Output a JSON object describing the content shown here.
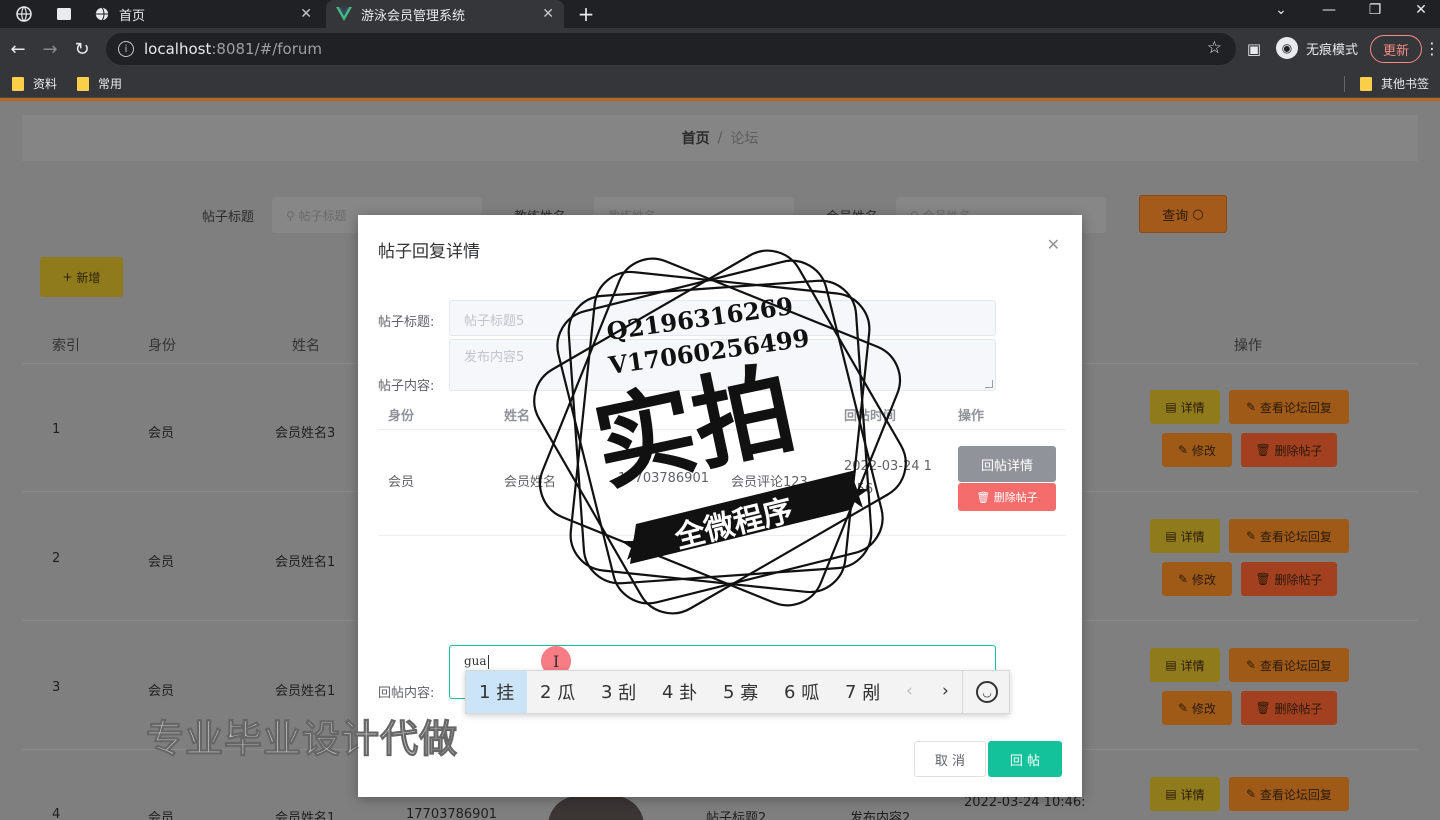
{
  "browser": {
    "tabs": [
      {
        "title": "首页",
        "active": false
      },
      {
        "title": "游泳会员管理系统",
        "active": true
      }
    ],
    "url_host": "localhost",
    "url_path": ":8081/#/forum",
    "profile_label": "无痕模式",
    "update_label": "更新",
    "bookmarks": [
      "资料",
      "常用"
    ],
    "other_bookmarks": "其他书签"
  },
  "page": {
    "breadcrumb": {
      "home": "首页",
      "current": "论坛"
    },
    "search": [
      {
        "label": "帖子标题",
        "placeholder": "帖子标题"
      },
      {
        "label": "教练姓名",
        "placeholder": "教练姓名"
      },
      {
        "label": "会员姓名",
        "placeholder": "会员姓名"
      }
    ],
    "query_label": "查询",
    "add_label": "新增",
    "columns": {
      "index": "索引",
      "identity": "身份",
      "name": "姓名",
      "actions": "操作"
    },
    "rows": [
      {
        "index": "1",
        "identity": "会员",
        "name": "会员姓名3"
      },
      {
        "index": "2",
        "identity": "会员",
        "name": "会员姓名1"
      },
      {
        "index": "3",
        "identity": "会员",
        "name": "会员姓名1"
      },
      {
        "index": "4",
        "identity": "会员",
        "name": "会员姓名1",
        "phone": "17703786901",
        "title": "帖子标题2",
        "content": "发布内容2",
        "time": "2022-03-24 10:46:"
      }
    ],
    "row_actions": {
      "detail": "详情",
      "view_reply": "查看论坛回复",
      "edit": "修改",
      "delete": "删除帖子"
    }
  },
  "dialog": {
    "title": "帖子回复详情",
    "post_title_label": "帖子标题:",
    "post_title_value": "帖子标题5",
    "post_content_label": "帖子内容:",
    "post_content_value": "发布内容5",
    "inner_columns": {
      "identity": "身份",
      "name": "姓名",
      "reply_time": "回帖时间",
      "actions": "操作"
    },
    "inner_row": {
      "identity": "会员",
      "name": "会员姓名",
      "phone": "17703786901",
      "reply": "会员评论123",
      "time": "2022-03-24 1",
      "time2": "0:56"
    },
    "reply_detail_label": "回帖详情",
    "delete_post_label": "删除帖子",
    "reply_content_label": "回帖内容:",
    "reply_input_value": "gua",
    "cancel_label": "取 消",
    "submit_label": "回 帖"
  },
  "ime": {
    "candidates": [
      {
        "num": "1",
        "char": "挂"
      },
      {
        "num": "2",
        "char": "瓜"
      },
      {
        "num": "3",
        "char": "刮"
      },
      {
        "num": "4",
        "char": "卦"
      },
      {
        "num": "5",
        "char": "寡"
      },
      {
        "num": "6",
        "char": "呱"
      },
      {
        "num": "7",
        "char": "剐"
      }
    ]
  },
  "watermark": {
    "line1": "Q2196316269",
    "line2": "V17060256499",
    "big": "实拍",
    "banner": "全微程序",
    "bottom": "专业毕业设计代做"
  },
  "colors": {
    "primary": "#13c29b",
    "danger": "#f56c6c",
    "info": "#909399",
    "accent_bar": "#b9651e"
  }
}
